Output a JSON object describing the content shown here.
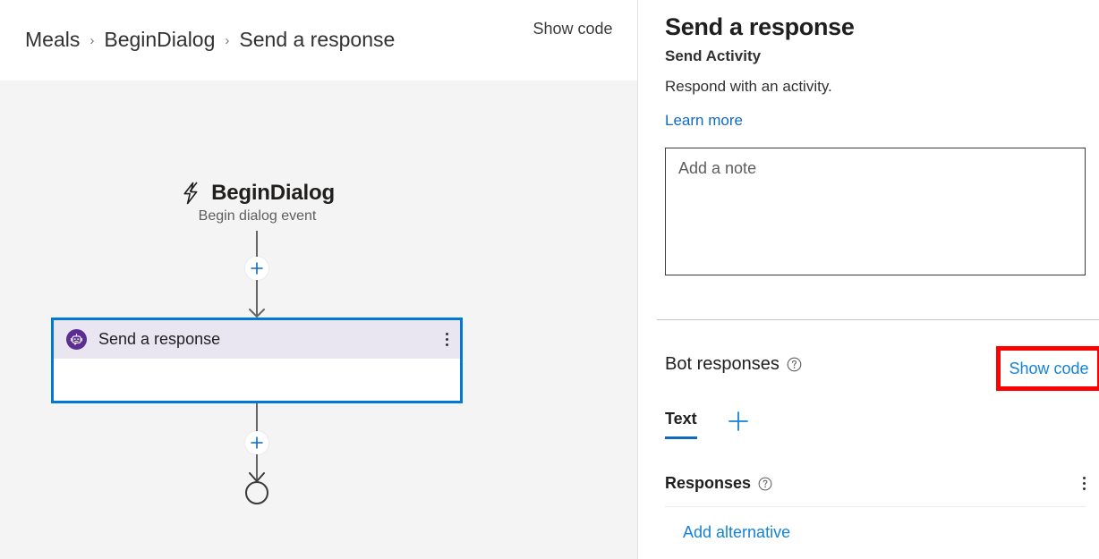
{
  "breadcrumb": {
    "items": [
      {
        "label": "Meals"
      },
      {
        "label": "BeginDialog"
      },
      {
        "label": "Send a response"
      }
    ],
    "separator": "›",
    "show_code_label": "Show\ncode"
  },
  "canvas": {
    "trigger": {
      "icon": "lightning-bolt-icon",
      "title": "BeginDialog",
      "subtitle": "Begin dialog event"
    },
    "add_button_label": "+",
    "action_node": {
      "icon": "bot-icon",
      "label": "Send a response",
      "menu_icon": "more-vertical-icon",
      "selected_border_color": "#0078d4",
      "header_color": "#e9e6f2",
      "icon_color": "#5c2e91"
    },
    "end_node": "end-circle"
  },
  "panel": {
    "title": "Send a response",
    "subtitle": "Send Activity",
    "description": "Respond with an activity.",
    "learn_more_label": "Learn more",
    "note_value": "",
    "note_placeholder": "Add a note",
    "bot_responses": {
      "label": "Bot responses",
      "help_icon": "question-circle-icon",
      "show_code_label": "Show code",
      "highlight_color": "#ff0000"
    },
    "tabs": [
      {
        "label": "Text",
        "active": true
      }
    ],
    "add_tab_icon": "plus-icon",
    "responses": {
      "label": "Responses",
      "help_icon": "question-circle-icon",
      "menu_icon": "more-vertical-icon"
    },
    "add_alternative_label": "Add alternative"
  },
  "colors": {
    "accent_blue": "#0f6cbd",
    "link_blue": "#1283d8",
    "purple": "#5c2e91",
    "canvas_bg": "#f4f4f4",
    "red_highlight": "#ff0000"
  }
}
